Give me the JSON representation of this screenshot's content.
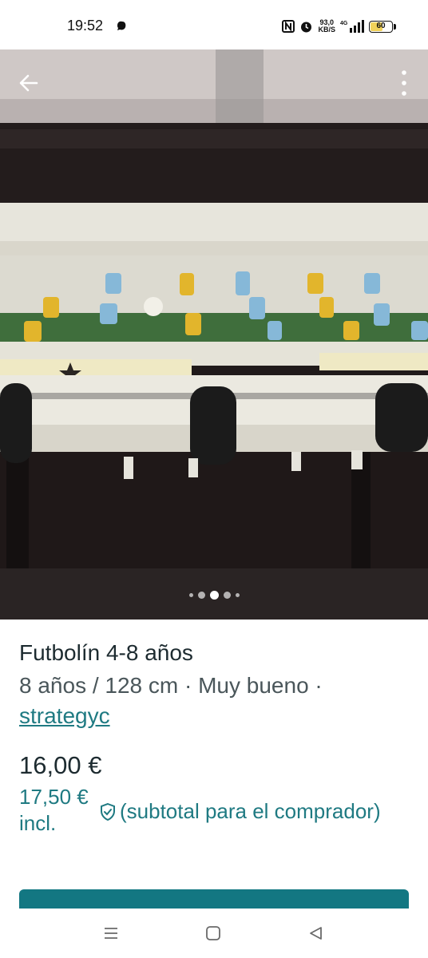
{
  "status_bar": {
    "time": "19:52",
    "speed_top": "93,0",
    "speed_bottom": "KB/S",
    "network": "4G",
    "battery": "60",
    "battery_level": 0.6
  },
  "toolbar": {
    "back_icon": "arrow-left-icon",
    "more_icon": "more-vertical-icon"
  },
  "gallery": {
    "image_subject": "foosball-table-photo",
    "pages": 5,
    "active_page": 3
  },
  "listing": {
    "title": "Futbolín 4-8 años",
    "attributes": "8 años / 128 cm · Muy bueno ·",
    "seller": "strategyc",
    "price": "16,00 €",
    "total_price": "17,50 € incl.",
    "buyer_protection_note": "(subtotal para el comprador)",
    "shield_icon": "shield-check-icon"
  },
  "colors": {
    "accent": "#137782",
    "link": "#1f7a82",
    "text": "#1d2b30"
  },
  "nav": {
    "recents_icon": "menu-lines-icon",
    "home_icon": "square-home-icon",
    "back_icon": "triangle-back-icon"
  }
}
